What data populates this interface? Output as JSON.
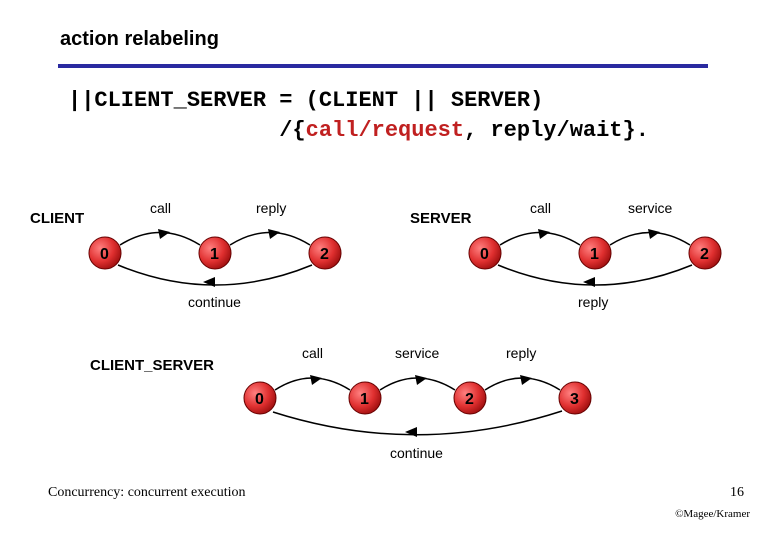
{
  "title": "action relabeling",
  "code_line1": "||CLIENT_SERVER = (CLIENT || SERVER)",
  "code_indent": "                /{",
  "code_hl": "call/request",
  "code_tail": ", reply/wait}.",
  "client": {
    "name": "CLIENT",
    "edge_a": "call",
    "edge_b": "reply",
    "edge_back": "continue",
    "s0": "0",
    "s1": "1",
    "s2": "2"
  },
  "server": {
    "name": "SERVER",
    "edge_a": "call",
    "edge_b": "service",
    "edge_back": "reply",
    "s0": "0",
    "s1": "1",
    "s2": "2"
  },
  "cs": {
    "name": "CLIENT_SERVER",
    "edge_a": "call",
    "edge_b": "service",
    "edge_c": "reply",
    "edge_back": "continue",
    "s0": "0",
    "s1": "1",
    "s2": "2",
    "s3": "3"
  },
  "footer": {
    "left": "Concurrency: concurrent execution",
    "page": "16",
    "copyright": "©Magee/Kramer"
  }
}
